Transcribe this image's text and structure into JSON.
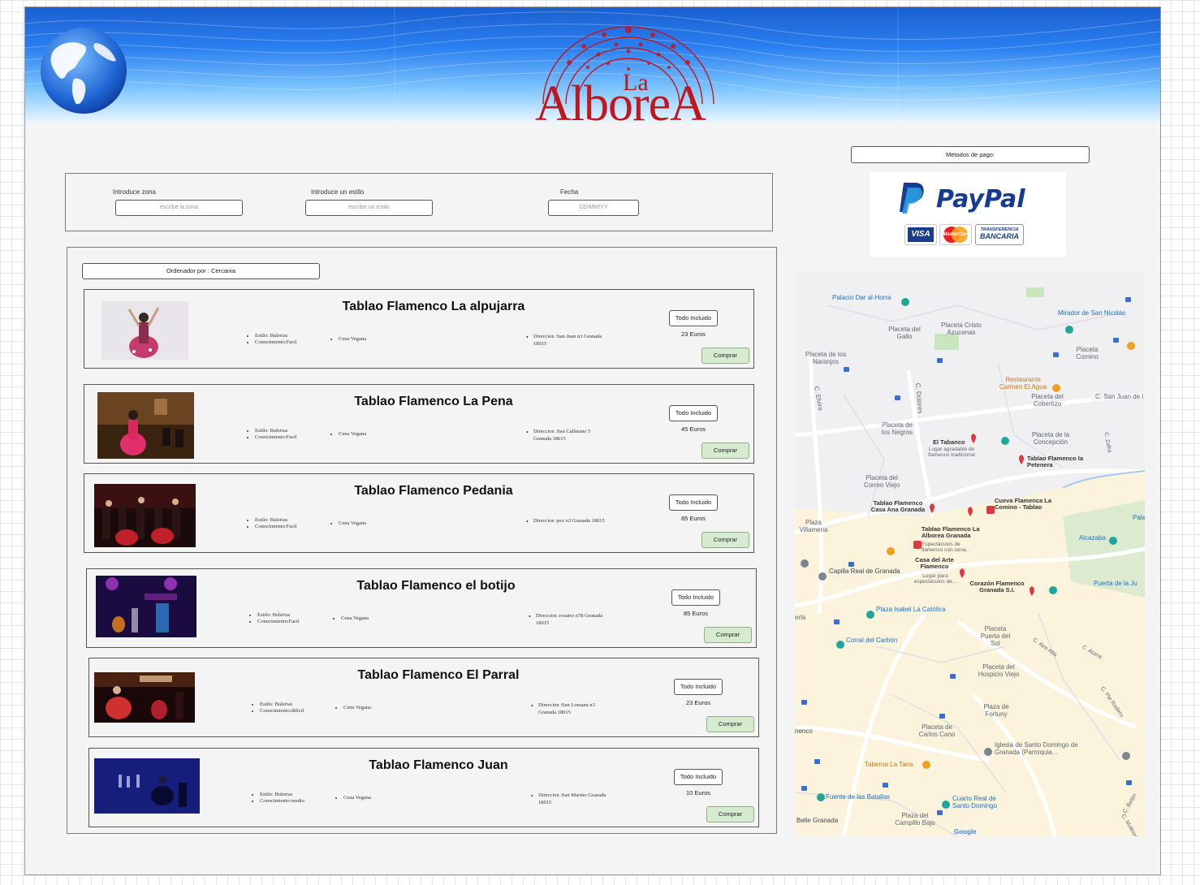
{
  "header": {
    "logo_small": "La",
    "logo_main": "AlboreA"
  },
  "search": {
    "zone_label": "Introduce zona",
    "zone_placeholder": "escribe la zona",
    "style_label": "Introduce un estilo",
    "style_placeholder": "escribe un estilo",
    "date_label": "Fecha",
    "date_placeholder": "DD/MM/YY"
  },
  "sort": {
    "label": "Ordenador por : Cercania"
  },
  "listings": [
    {
      "title": "Tablao Flamenco La alpujarra",
      "style": "Estilo: Bulerias",
      "level": "Conocimiento:Facil",
      "extra": "Cena Vegana",
      "address": "Direccion :San Juan n3 Granada 18015",
      "tag": "Todo Incluido",
      "price": "23 Euros",
      "buy": "Comprar"
    },
    {
      "title": "Tablao Flamenco La Pena",
      "style": "Estilo: Bulerias",
      "level": "Conocimiento:Facil",
      "extra": "Cena Vegana",
      "address": "Direccion :San Calletano 5 Granada 18015",
      "tag": "Todo Incluido",
      "price": "45 Euros",
      "buy": "Comprar"
    },
    {
      "title": "Tablao Flamenco Pedania",
      "style": "Estilo: Bulerias",
      "level": "Conocimiento:Facil",
      "extra": "Cena Vegana",
      "address": "Direccion :pez n3 Granada 18015",
      "tag": "Todo Incluido",
      "price": "85 Euros",
      "buy": "Comprar"
    },
    {
      "title": "Tablao Flamenco el botijo",
      "style": "Estilo: Bulerias",
      "level": "Conocimiento:Facil",
      "extra": "Cena Vegana",
      "address": "Direccion :rosario n78 Granada 18015",
      "tag": "Todo Incluido",
      "price": "85 Euros",
      "buy": "Comprar"
    },
    {
      "title": "Tablao Flamenco El Parral",
      "style": "Estilo: Bulerias",
      "level": "Conocimiento:dificil",
      "extra": "Cena Vegana",
      "address": "Direccion :San Lomana n3 Granada 18015",
      "tag": "Todo Incluido",
      "price": "23 Euros",
      "buy": "Comprar"
    },
    {
      "title": "Tablao Flamenco Juan",
      "style": "Estilo: Bulerias",
      "level": "Conocimiento:medio",
      "extra": "Cena Vegana",
      "address": "Direccion :San Marino Granada 18015",
      "tag": "Todo Incluido",
      "price": "10 Euros",
      "buy": "Comprar"
    }
  ],
  "payment": {
    "label": "Metodos de pago:",
    "paypal_text": "PayPal",
    "visa": "VISA",
    "mastercard": "MasterCard",
    "transfer_1": "TRANSFERENCIA",
    "transfer_2": "BANCARIA"
  },
  "map": {
    "labels": [
      "Palacio Dar al-Horra",
      "Mirador de San Nicolás",
      "Placeta del Gallo",
      "Placeta Cristo Azucenas",
      "Placeta de los Naranjos",
      "Placeta Comino",
      "Restaurante Carmen El Agua",
      "Placeta del Cobertizo",
      "C. San Juan de l",
      "C. Elvira",
      "C. Dolores",
      "El Tabanco",
      "Lugar agradable de flamenco tradicional",
      "Placeta de la Concepción",
      "Placeta de los Negros",
      "Tablao Flamenco la Petenera",
      "Placeta del Correo Viejo",
      "Tablao Flamenco Casa Ana Granada",
      "Cueva Flamenca La Comino - Tablao",
      "Plaza Villamena",
      "Tablao Flamenco La Alborea Granada",
      "Espectáculos de flamenco con cena..",
      "Alcazaba",
      "Palac",
      "Casa del Arte Flamenco",
      "Lugar para espectáculos de...",
      "Capilla Real de Granada",
      "Corazón Flamenco Granada S.I.",
      "Puerta de la Ju",
      "Plaza Isabel La Católica",
      "Corral del Carbón",
      "Placeta Puerta del Sol",
      "C. Acera",
      "C. Aire Alta",
      "C. Pie Rodero",
      "Plaza de Fortuny",
      "Placeta del Hospicio Viejo",
      "Placeta de Carlos Cano",
      "Iglesia de Santo Domingo de Granada (Parroquia...",
      "Taberna La Tana",
      "Fuente de las Batallas",
      "Cuarto Real de Santo Domingo",
      "Plaza del Campillo Bajo",
      "Belle Granada",
      "Google",
      "erla",
      "nenco",
      "C. Zafra",
      "C. Belén",
      "C. Molinos"
    ]
  },
  "colors": {
    "accent_red": "#c0171e",
    "buy_green": "#d6ebcf",
    "map_blue": "#1a73c8",
    "map_red": "#e0383e"
  }
}
